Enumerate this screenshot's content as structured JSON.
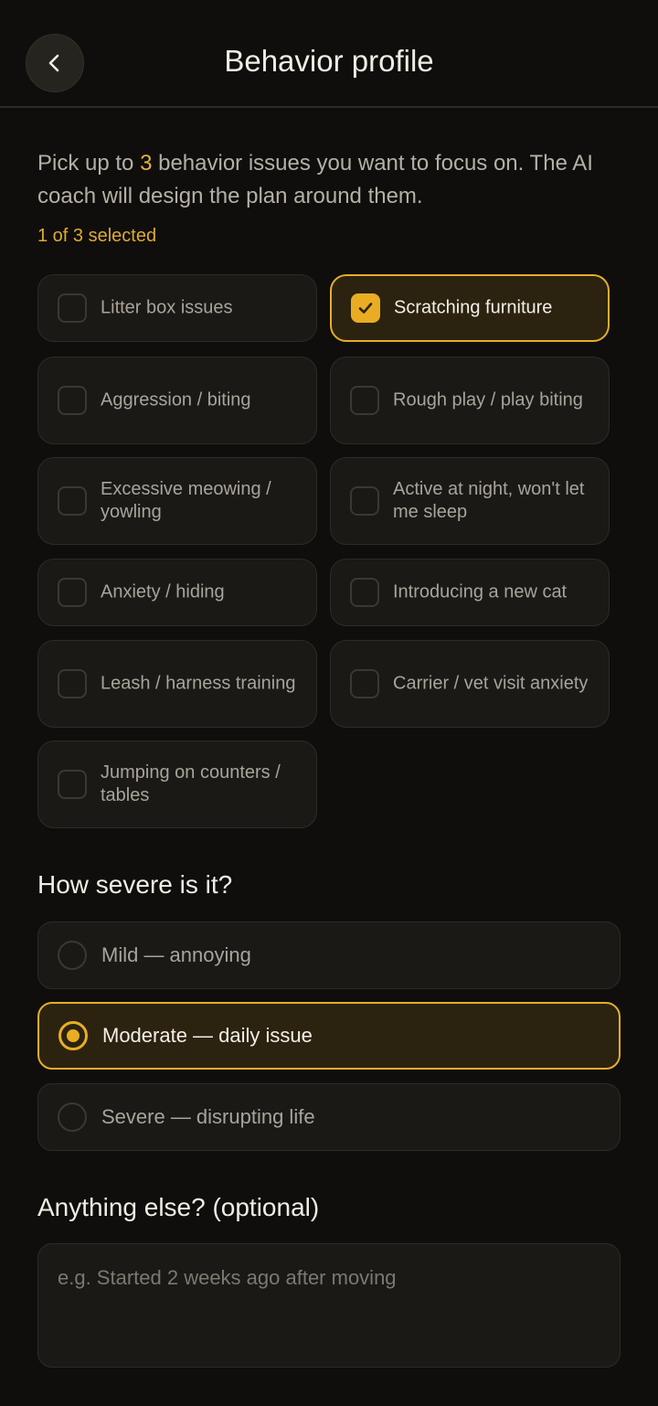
{
  "header": {
    "title": "Behavior profile",
    "back_icon": "chevron-left-icon"
  },
  "intro": {
    "before": "Pick up to ",
    "limit": "3",
    "after": " behavior issues you want to focus on. The AI coach will design the plan around them."
  },
  "selection_count": "1 of 3 selected",
  "issues": [
    {
      "label": "Litter box issues",
      "selected": false
    },
    {
      "label": "Scratching furniture",
      "selected": true
    },
    {
      "label": "Aggression / biting",
      "selected": false
    },
    {
      "label": "Rough play / play biting",
      "selected": false
    },
    {
      "label": "Excessive meowing / yowling",
      "selected": false
    },
    {
      "label": "Active at night, won't let me sleep",
      "selected": false
    },
    {
      "label": "Anxiety / hiding",
      "selected": false
    },
    {
      "label": "Introducing a new cat",
      "selected": false
    },
    {
      "label": "Leash / harness training",
      "selected": false
    },
    {
      "label": "Carrier / vet visit anxiety",
      "selected": false
    },
    {
      "label": "Jumping on counters / tables",
      "selected": false
    }
  ],
  "severity": {
    "title": "How severe is it?",
    "options": [
      {
        "label": "Mild — annoying",
        "selected": false
      },
      {
        "label": "Moderate — daily issue",
        "selected": true
      },
      {
        "label": "Severe — disrupting life",
        "selected": false
      }
    ]
  },
  "notes": {
    "title": "Anything else? (optional)",
    "placeholder": "e.g. Started 2 weeks ago after moving",
    "value": ""
  },
  "colors": {
    "accent": "#e9ad24",
    "background": "#0f0e0c",
    "card": "#1a1916",
    "selected_card": "#2b2310"
  }
}
